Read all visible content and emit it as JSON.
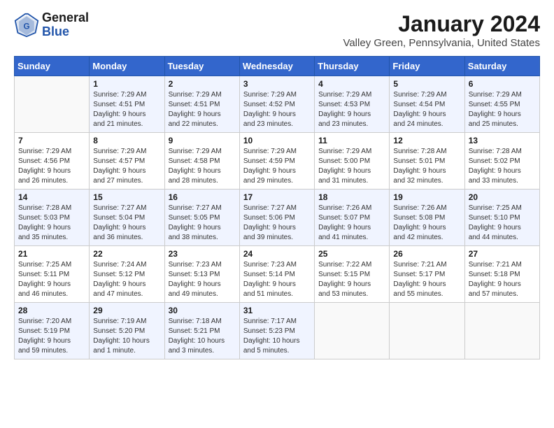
{
  "header": {
    "logo_line1": "General",
    "logo_line2": "Blue",
    "month_title": "January 2024",
    "location": "Valley Green, Pennsylvania, United States"
  },
  "days_of_week": [
    "Sunday",
    "Monday",
    "Tuesday",
    "Wednesday",
    "Thursday",
    "Friday",
    "Saturday"
  ],
  "weeks": [
    [
      {
        "day": "",
        "info": ""
      },
      {
        "day": "1",
        "info": "Sunrise: 7:29 AM\nSunset: 4:51 PM\nDaylight: 9 hours\nand 21 minutes."
      },
      {
        "day": "2",
        "info": "Sunrise: 7:29 AM\nSunset: 4:51 PM\nDaylight: 9 hours\nand 22 minutes."
      },
      {
        "day": "3",
        "info": "Sunrise: 7:29 AM\nSunset: 4:52 PM\nDaylight: 9 hours\nand 23 minutes."
      },
      {
        "day": "4",
        "info": "Sunrise: 7:29 AM\nSunset: 4:53 PM\nDaylight: 9 hours\nand 23 minutes."
      },
      {
        "day": "5",
        "info": "Sunrise: 7:29 AM\nSunset: 4:54 PM\nDaylight: 9 hours\nand 24 minutes."
      },
      {
        "day": "6",
        "info": "Sunrise: 7:29 AM\nSunset: 4:55 PM\nDaylight: 9 hours\nand 25 minutes."
      }
    ],
    [
      {
        "day": "7",
        "info": "Sunrise: 7:29 AM\nSunset: 4:56 PM\nDaylight: 9 hours\nand 26 minutes."
      },
      {
        "day": "8",
        "info": "Sunrise: 7:29 AM\nSunset: 4:57 PM\nDaylight: 9 hours\nand 27 minutes."
      },
      {
        "day": "9",
        "info": "Sunrise: 7:29 AM\nSunset: 4:58 PM\nDaylight: 9 hours\nand 28 minutes."
      },
      {
        "day": "10",
        "info": "Sunrise: 7:29 AM\nSunset: 4:59 PM\nDaylight: 9 hours\nand 29 minutes."
      },
      {
        "day": "11",
        "info": "Sunrise: 7:29 AM\nSunset: 5:00 PM\nDaylight: 9 hours\nand 31 minutes."
      },
      {
        "day": "12",
        "info": "Sunrise: 7:28 AM\nSunset: 5:01 PM\nDaylight: 9 hours\nand 32 minutes."
      },
      {
        "day": "13",
        "info": "Sunrise: 7:28 AM\nSunset: 5:02 PM\nDaylight: 9 hours\nand 33 minutes."
      }
    ],
    [
      {
        "day": "14",
        "info": "Sunrise: 7:28 AM\nSunset: 5:03 PM\nDaylight: 9 hours\nand 35 minutes."
      },
      {
        "day": "15",
        "info": "Sunrise: 7:27 AM\nSunset: 5:04 PM\nDaylight: 9 hours\nand 36 minutes."
      },
      {
        "day": "16",
        "info": "Sunrise: 7:27 AM\nSunset: 5:05 PM\nDaylight: 9 hours\nand 38 minutes."
      },
      {
        "day": "17",
        "info": "Sunrise: 7:27 AM\nSunset: 5:06 PM\nDaylight: 9 hours\nand 39 minutes."
      },
      {
        "day": "18",
        "info": "Sunrise: 7:26 AM\nSunset: 5:07 PM\nDaylight: 9 hours\nand 41 minutes."
      },
      {
        "day": "19",
        "info": "Sunrise: 7:26 AM\nSunset: 5:08 PM\nDaylight: 9 hours\nand 42 minutes."
      },
      {
        "day": "20",
        "info": "Sunrise: 7:25 AM\nSunset: 5:10 PM\nDaylight: 9 hours\nand 44 minutes."
      }
    ],
    [
      {
        "day": "21",
        "info": "Sunrise: 7:25 AM\nSunset: 5:11 PM\nDaylight: 9 hours\nand 46 minutes."
      },
      {
        "day": "22",
        "info": "Sunrise: 7:24 AM\nSunset: 5:12 PM\nDaylight: 9 hours\nand 47 minutes."
      },
      {
        "day": "23",
        "info": "Sunrise: 7:23 AM\nSunset: 5:13 PM\nDaylight: 9 hours\nand 49 minutes."
      },
      {
        "day": "24",
        "info": "Sunrise: 7:23 AM\nSunset: 5:14 PM\nDaylight: 9 hours\nand 51 minutes."
      },
      {
        "day": "25",
        "info": "Sunrise: 7:22 AM\nSunset: 5:15 PM\nDaylight: 9 hours\nand 53 minutes."
      },
      {
        "day": "26",
        "info": "Sunrise: 7:21 AM\nSunset: 5:17 PM\nDaylight: 9 hours\nand 55 minutes."
      },
      {
        "day": "27",
        "info": "Sunrise: 7:21 AM\nSunset: 5:18 PM\nDaylight: 9 hours\nand 57 minutes."
      }
    ],
    [
      {
        "day": "28",
        "info": "Sunrise: 7:20 AM\nSunset: 5:19 PM\nDaylight: 9 hours\nand 59 minutes."
      },
      {
        "day": "29",
        "info": "Sunrise: 7:19 AM\nSunset: 5:20 PM\nDaylight: 10 hours\nand 1 minute."
      },
      {
        "day": "30",
        "info": "Sunrise: 7:18 AM\nSunset: 5:21 PM\nDaylight: 10 hours\nand 3 minutes."
      },
      {
        "day": "31",
        "info": "Sunrise: 7:17 AM\nSunset: 5:23 PM\nDaylight: 10 hours\nand 5 minutes."
      },
      {
        "day": "",
        "info": ""
      },
      {
        "day": "",
        "info": ""
      },
      {
        "day": "",
        "info": ""
      }
    ]
  ]
}
